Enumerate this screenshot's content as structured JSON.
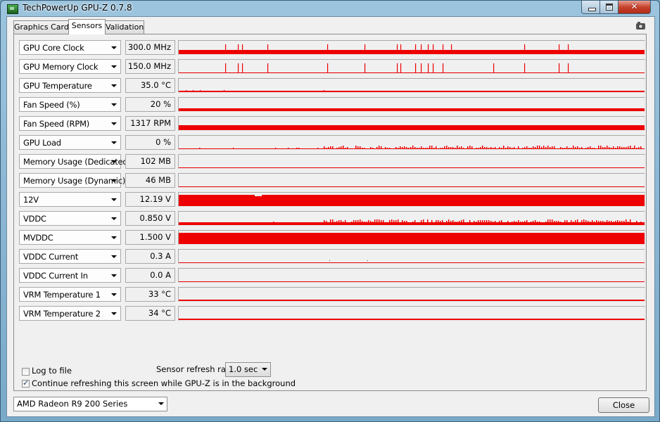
{
  "window": {
    "title": "TechPowerUp GPU-Z 0.7.8"
  },
  "tabs": [
    "Graphics Card",
    "Sensors",
    "Validation"
  ],
  "colors": {
    "graph": "#ee0000",
    "panel": "#f0f0f0"
  },
  "sensors": [
    {
      "name": "GPU Core Clock",
      "value": "300.0 MHz",
      "level": 0.3,
      "spikes": [
        66,
        84,
        90,
        126,
        211,
        264,
        310,
        315,
        336,
        344,
        354,
        361,
        375,
        387,
        491,
        540,
        553
      ]
    },
    {
      "name": "GPU Memory Clock",
      "value": "150.0 MHz",
      "level": 0.0,
      "spikes": [
        66,
        84,
        90,
        126,
        211,
        264,
        310,
        315,
        336,
        344,
        354,
        361,
        375,
        447,
        491,
        540,
        553
      ]
    },
    {
      "name": "GPU Temperature",
      "value": "35.0 °C",
      "level": 0.08,
      "spikes": [
        10,
        20,
        30,
        64,
        206
      ],
      "spikeHeight": 0.15
    },
    {
      "name": "Fan Speed (%)",
      "value": "20 %",
      "level": 0.2,
      "spikes": []
    },
    {
      "name": "Fan Speed (RPM)",
      "value": "1317 RPM",
      "level": 0.38,
      "spikes": []
    },
    {
      "name": "GPU Load",
      "value": "0 %",
      "level": 0.0,
      "noise": true
    },
    {
      "name": "Memory Usage (Dedicated)",
      "value": "102 MB",
      "level": 0.03,
      "spikes": []
    },
    {
      "name": "Memory Usage (Dynamic)",
      "value": "46 MB",
      "level": 0.02,
      "spikes": []
    },
    {
      "name": "12V",
      "value": "12.19 V",
      "level": 0.85,
      "spikes": []
    },
    {
      "name": "VDDC",
      "value": "0.850 V",
      "level": 0.22,
      "noise": true
    },
    {
      "name": "MVDDC",
      "value": "1.500 V",
      "level": 0.85,
      "spikes": []
    },
    {
      "name": "VDDC Current",
      "value": "0.3 A",
      "level": 0.0,
      "dots": [
        214,
        268
      ]
    },
    {
      "name": "VDDC Current In",
      "value": "0.0 A",
      "level": 0.0,
      "spikes": []
    },
    {
      "name": "VRM Temperature 1",
      "value": "33 °C",
      "level": 0.1,
      "spikes": []
    },
    {
      "name": "VRM Temperature 2",
      "value": "34 °C",
      "level": 0.1,
      "spikes": []
    }
  ],
  "options": {
    "log_to_file": {
      "label": "Log to file",
      "checked": false
    },
    "refresh_label": "Sensor refresh rate:",
    "refresh_value": "1.0 sec",
    "background_refresh": {
      "label": "Continue refreshing this screen while GPU-Z is in the background",
      "checked": true
    }
  },
  "footer": {
    "gpu_select": "AMD Radeon R9 200 Series",
    "close_label": "Close"
  }
}
